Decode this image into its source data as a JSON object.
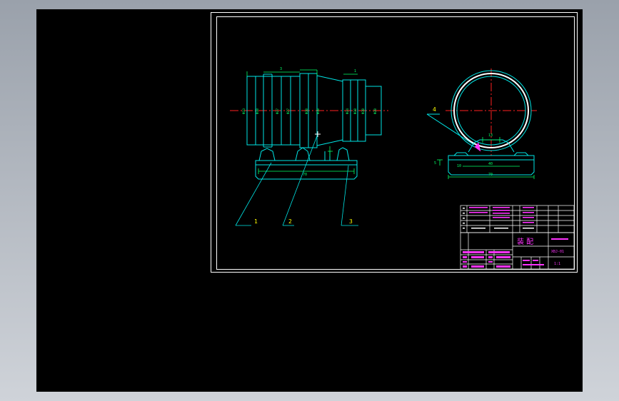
{
  "colors": {
    "background": "#000000",
    "frame": "#ffffff",
    "outline": "#00e5e5",
    "dimension": "#00ff66",
    "centerline": "#ff2020",
    "title_text": "#ff33ff",
    "detail": "#ffff00"
  },
  "front_view": {
    "callouts": [
      "1",
      "2",
      "3"
    ],
    "top_dims": [
      "3",
      "1"
    ],
    "bottom_dim": "70",
    "diameters": [
      "Φ33",
      "Φ30",
      "Φ27",
      "Φ27",
      "Φ30",
      "Φ30",
      "Φ24",
      "Φ30",
      "Φ30",
      "Φ20"
    ]
  },
  "side_view": {
    "callout": "4",
    "top_dim": "13",
    "inner_dim": "40",
    "outer_dim": "70",
    "height_dim": "5",
    "left_dim": "10"
  },
  "title_block": {
    "part_name": "装 配",
    "code": "XBJ-01",
    "scale": "1:1"
  }
}
